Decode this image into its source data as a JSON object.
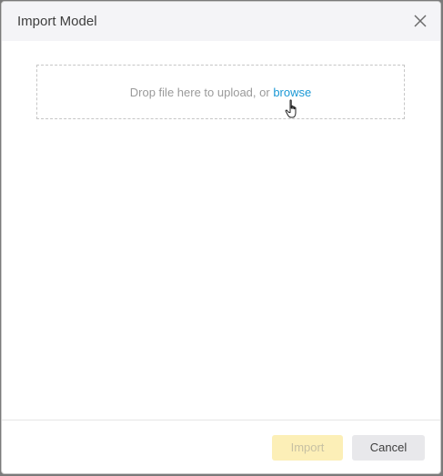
{
  "dialog": {
    "title": "Import Model",
    "close_icon": "close-icon"
  },
  "dropzone": {
    "text": "Drop file here to upload, or ",
    "link_label": "browse"
  },
  "footer": {
    "import_label": "Import",
    "cancel_label": "Cancel"
  },
  "colors": {
    "link": "#1a98d5",
    "import_disabled_bg": "#fcefb7",
    "cancel_bg": "#e8e8eb",
    "header_bg": "#f4f4f7"
  }
}
